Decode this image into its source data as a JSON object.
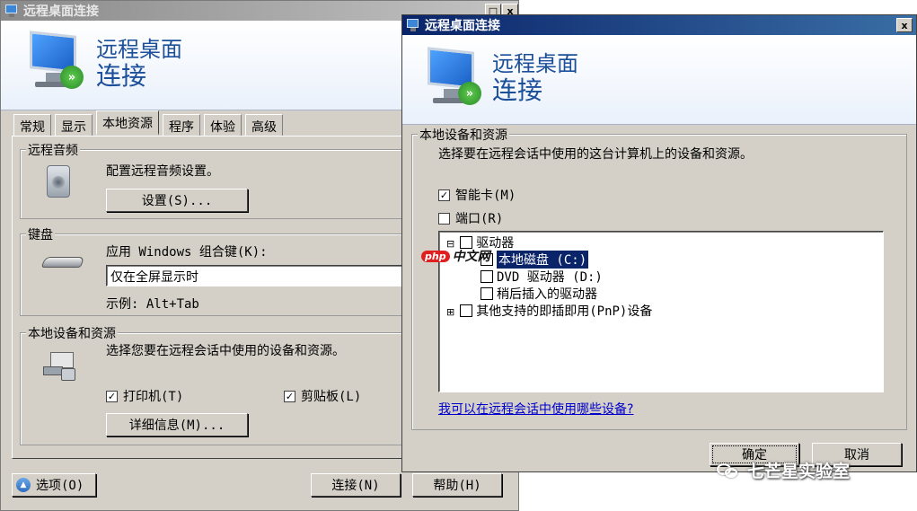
{
  "back_window": {
    "title": "远程桌面连接",
    "title_buttons": [
      "□",
      "x"
    ],
    "banner_line1": "远程桌面",
    "banner_line2": "连接",
    "tabs": [
      "常规",
      "显示",
      "本地资源",
      "程序",
      "体验",
      "高级"
    ],
    "active_tab": "本地资源",
    "audio": {
      "group_label": "远程音频",
      "description": "配置远程音频设置。",
      "button_label": "设置(S)..."
    },
    "keyboard": {
      "group_label": "键盘",
      "description": "应用 Windows 组合键(K):",
      "dropdown_value": "仅在全屏显示时",
      "example": "示例: Alt+Tab"
    },
    "local": {
      "group_label": "本地设备和资源",
      "description": "选择您要在远程会话中使用的设备和资源。",
      "printer_label": "打印机(T)",
      "printer_checked": true,
      "clipboard_label": "剪贴板(L)",
      "clipboard_checked": true,
      "details_button": "详细信息(M)..."
    },
    "options_button": "选项(O)",
    "connect_button": "连接(N)",
    "help_button": "帮助(H)"
  },
  "front_window": {
    "title": "远程桌面连接",
    "close_glyph": "x",
    "banner_line1": "远程桌面",
    "banner_line2": "连接",
    "group_label": "本地设备和资源",
    "description": "选择要在远程会话中使用的这台计算机上的设备和资源。",
    "smartcard_label": "智能卡(M)",
    "smartcard_checked": true,
    "ports_label": "端口(R)",
    "ports_checked": false,
    "tree": {
      "drives_label": "驱动器",
      "drives_expander": "⊟",
      "drive_c": "本地磁盘 (C:)",
      "drive_dvd": "DVD 驱动器 (D:)",
      "drive_later": "稍后插入的驱动器",
      "pnp_label": "其他支持的即插即用(PnP)设备",
      "pnp_expander": "⊞"
    },
    "link_text": "我可以在远程会话中使用哪些设备?",
    "ok_button": "确定",
    "cancel_button": "取消"
  },
  "overlays": {
    "php_badge": "php",
    "php_text": "中文网",
    "watermark_text": "七芒星实验室"
  },
  "colors": {
    "dialog_face": "#d4d0c8",
    "active_title": "#0a246a",
    "banner_text": "#1b4f9a",
    "link": "#0000cc",
    "selection": "#0a246a"
  }
}
